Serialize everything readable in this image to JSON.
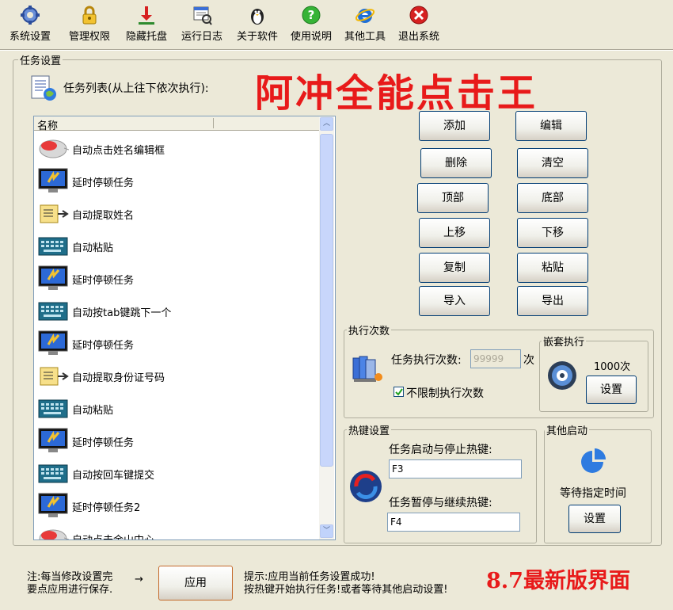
{
  "toolbar": {
    "items": [
      {
        "label": "系统设置",
        "icon": "gear-icon"
      },
      {
        "label": "管理权限",
        "icon": "lock-icon"
      },
      {
        "label": "隐藏托盘",
        "icon": "minimize-tray-icon"
      },
      {
        "label": "运行日志",
        "icon": "log-icon"
      },
      {
        "label": "关于软件",
        "icon": "about-icon"
      },
      {
        "label": "使用说明",
        "icon": "help-icon"
      },
      {
        "label": "其他工具",
        "icon": "ie-icon"
      },
      {
        "label": "退出系统",
        "icon": "exit-icon"
      }
    ]
  },
  "task_settings": {
    "title": "任务设置",
    "list_caption": "任务列表(从上往下依次执行):",
    "banner": "阿冲全能点击王",
    "column_header": "名称",
    "tasks": [
      {
        "label": "自动点击姓名编辑框",
        "icon": "mouse-icon"
      },
      {
        "label": "延时停顿任务",
        "icon": "delay-monitor-icon"
      },
      {
        "label": "自动提取姓名",
        "icon": "extract-icon"
      },
      {
        "label": "自动粘贴",
        "icon": "keyboard-icon"
      },
      {
        "label": "延时停顿任务",
        "icon": "delay-monitor-icon"
      },
      {
        "label": "自动按tab键跳下一个",
        "icon": "keyboard-icon"
      },
      {
        "label": "延时停顿任务",
        "icon": "delay-monitor-icon"
      },
      {
        "label": "自动提取身份证号码",
        "icon": "extract-icon"
      },
      {
        "label": "自动粘贴",
        "icon": "keyboard-icon"
      },
      {
        "label": "延时停顿任务",
        "icon": "delay-monitor-icon"
      },
      {
        "label": "自动按回车键提交",
        "icon": "keyboard-icon"
      },
      {
        "label": "延时停顿任务2",
        "icon": "delay-monitor-icon"
      },
      {
        "label": "自动点击金山中心",
        "icon": "mouse-icon"
      }
    ]
  },
  "buttons": {
    "add": "添加",
    "edit": "编辑",
    "delete": "删除",
    "clear": "清空",
    "top": "顶部",
    "bottom": "底部",
    "up": "上移",
    "down": "下移",
    "copy": "复制",
    "paste": "粘贴",
    "import": "导入",
    "export": "导出"
  },
  "exec_count": {
    "title": "执行次数",
    "label": "任务执行次数:",
    "value": "99999",
    "unit": "次",
    "unlimited_label": "不限制执行次数",
    "unlimited_checked": true
  },
  "nested": {
    "title": "嵌套执行",
    "count": "1000次",
    "button": "设置"
  },
  "hotkeys": {
    "title": "热键设置",
    "start_label": "任务启动与停止热键:",
    "start_value": "F3",
    "pause_label": "任务暂停与继续热键:",
    "pause_value": "F4"
  },
  "other_start": {
    "title": "其他启动",
    "label": "等待指定时间",
    "button": "设置"
  },
  "footer": {
    "note_line1": "注:每当修改设置完",
    "note_line2": "要点应用进行保存.",
    "arrow": "→",
    "apply": "应用",
    "hint_line1": "提示:应用当前任务设置成功!",
    "hint_line2": "按热键开始执行任务!或者等待其他启动设置!",
    "version": "8.7最新版界面"
  }
}
